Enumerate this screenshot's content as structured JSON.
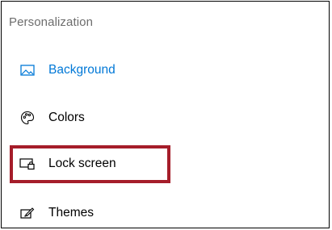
{
  "section": {
    "title": "Personalization"
  },
  "nav": {
    "items": [
      {
        "label": "Background",
        "icon": "image-icon",
        "active": true
      },
      {
        "label": "Colors",
        "icon": "palette-icon",
        "active": false
      },
      {
        "label": "Lock screen",
        "icon": "lock-screen-icon",
        "active": false,
        "highlighted": true
      },
      {
        "label": "Themes",
        "icon": "themes-icon",
        "active": false
      }
    ]
  },
  "colors": {
    "accent": "#0078d7",
    "highlight_border": "#a51d2a",
    "section_title": "#6d6d6d"
  }
}
